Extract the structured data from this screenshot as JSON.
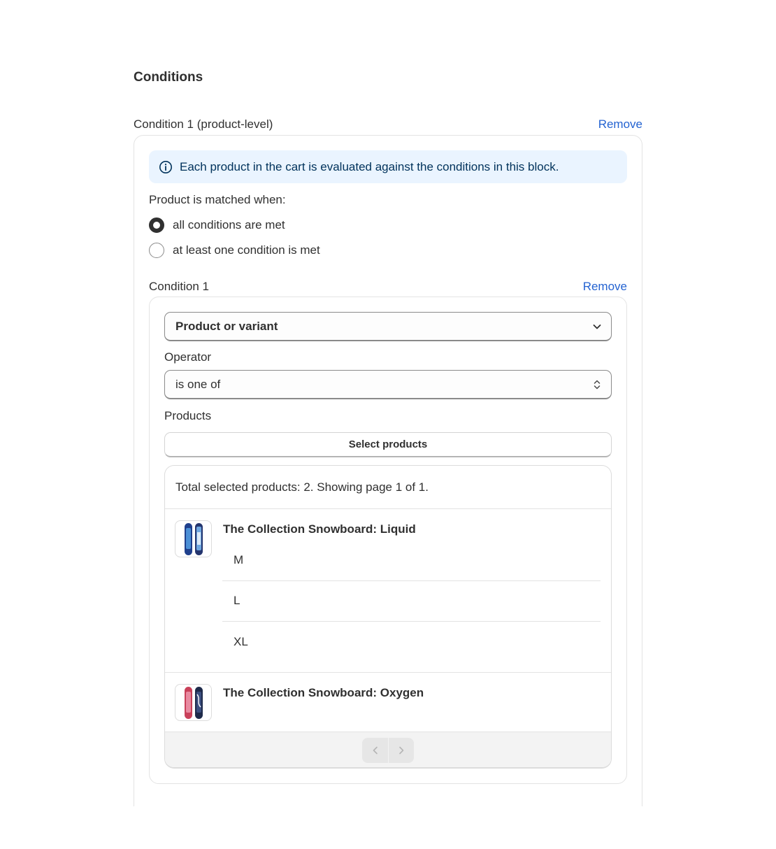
{
  "section": {
    "title": "Conditions"
  },
  "outer_condition": {
    "label": "Condition 1 (product-level)",
    "remove_label": "Remove",
    "banner_text": "Each product in the cart is evaluated against the conditions in this block.",
    "matched_label": "Product is matched when:",
    "options": [
      {
        "label": "all conditions are met",
        "checked": true
      },
      {
        "label": "at least one condition is met",
        "checked": false
      }
    ]
  },
  "inner_condition": {
    "label": "Condition 1",
    "remove_label": "Remove",
    "type_value": "Product or variant",
    "operator_label": "Operator",
    "operator_value": "is one of",
    "products_label": "Products",
    "select_button_label": "Select products"
  },
  "product_list": {
    "summary": "Total selected products: 2. Showing page 1 of 1.",
    "products": [
      {
        "title": "The Collection Snowboard: Liquid",
        "variants": [
          "M",
          "L",
          "XL"
        ]
      },
      {
        "title": "The Collection Snowboard: Oxygen",
        "variants": []
      }
    ],
    "pagination": {
      "prev_icon": "chevron-left-icon",
      "next_icon": "chevron-right-icon"
    }
  },
  "colors": {
    "link": "#2463d1",
    "banner_bg": "#eaf4ff",
    "banner_text": "#00325b",
    "text": "#303030"
  }
}
